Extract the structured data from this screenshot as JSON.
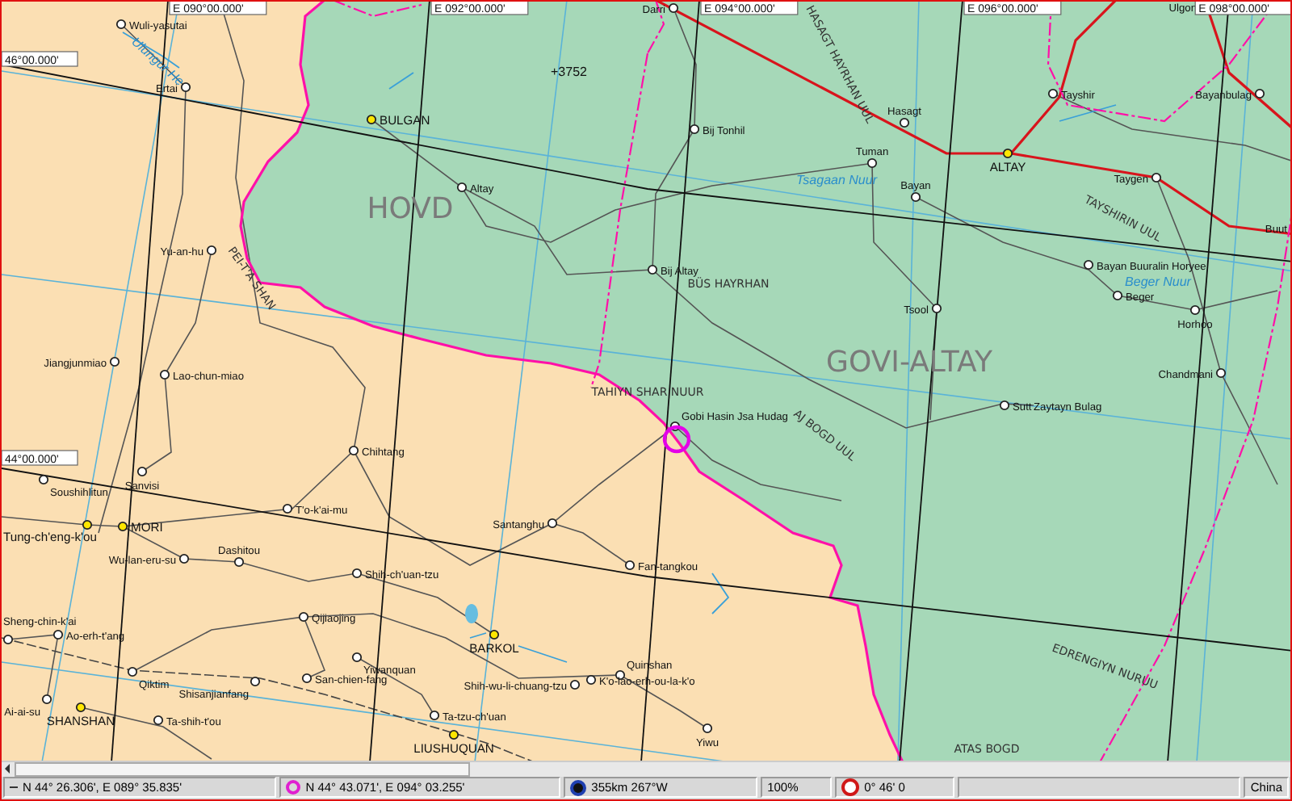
{
  "map": {
    "grid_labels": [
      {
        "text": "E 090°00.000'",
        "kind": "meridian"
      },
      {
        "text": "E 092°00.000'",
        "kind": "meridian"
      },
      {
        "text": "E 094°00.000'",
        "kind": "meridian"
      },
      {
        "text": "E 096°00.000'",
        "kind": "meridian"
      },
      {
        "text": "E 098°00.000'",
        "kind": "meridian"
      },
      {
        "text": "46°00.000'",
        "kind": "parallel"
      },
      {
        "text": "44°00.000'",
        "kind": "parallel"
      }
    ],
    "features": [
      {
        "name": "HOVD",
        "kind": "region"
      },
      {
        "name": "GOVI-ALTAY",
        "kind": "region"
      },
      {
        "name": "Ulungur He",
        "kind": "water"
      },
      {
        "name": "Tsagaan Nuur",
        "kind": "water"
      },
      {
        "name": "Beger Nuur",
        "kind": "water"
      },
      {
        "name": "PEI-T'A SHAN",
        "kind": "range"
      },
      {
        "name": "HASAGT HAYRHAN UUL",
        "kind": "range"
      },
      {
        "name": "TAYSHIRIN UUL",
        "kind": "range"
      },
      {
        "name": "BÜS HAYRHAN",
        "kind": "range"
      },
      {
        "name": "TAHIYN SHAR NUUR",
        "kind": "range"
      },
      {
        "name": "AJ BOGD UUL",
        "kind": "range"
      },
      {
        "name": "EDRENGIYN NURUU",
        "kind": "range"
      },
      {
        "name": "ATAS BOGD",
        "kind": "range"
      },
      {
        "name": "+3752",
        "kind": "peak"
      }
    ],
    "places": [
      {
        "name": "Wuli-yasutai",
        "kind": "town"
      },
      {
        "name": "Darri",
        "kind": "town"
      },
      {
        "name": "Ulgon",
        "kind": "town"
      },
      {
        "name": "Ertai",
        "kind": "town"
      },
      {
        "name": "Bayanbulag",
        "kind": "town"
      },
      {
        "name": "Tayshir",
        "kind": "town"
      },
      {
        "name": "BULGAN",
        "kind": "city"
      },
      {
        "name": "Hasagt",
        "kind": "town"
      },
      {
        "name": "Bij Tonhil",
        "kind": "town"
      },
      {
        "name": "ALTAY",
        "kind": "city"
      },
      {
        "name": "Tuman",
        "kind": "town"
      },
      {
        "name": "Taygen",
        "kind": "town"
      },
      {
        "name": "Altay",
        "kind": "town"
      },
      {
        "name": "Bayan",
        "kind": "town"
      },
      {
        "name": "Buut",
        "kind": "label"
      },
      {
        "name": "Yu-an-hu",
        "kind": "town"
      },
      {
        "name": "Bij Altay",
        "kind": "town"
      },
      {
        "name": "Bayan Buuralin Horyee",
        "kind": "town"
      },
      {
        "name": "Beger",
        "kind": "town"
      },
      {
        "name": "Tsool",
        "kind": "town"
      },
      {
        "name": "Horhoo",
        "kind": "town"
      },
      {
        "name": "Jiangjunmiao",
        "kind": "town"
      },
      {
        "name": "Lao-chun-miao",
        "kind": "town"
      },
      {
        "name": "Chandmani",
        "kind": "town"
      },
      {
        "name": "Sutt",
        "kind": "town"
      },
      {
        "name": "Zaytayn Bulag",
        "kind": "label"
      },
      {
        "name": "Gobi Hasin Jsa Hudag",
        "kind": "town"
      },
      {
        "name": "Chihtang",
        "kind": "town"
      },
      {
        "name": "Sanvisi",
        "kind": "town"
      },
      {
        "name": "Soushihlitun",
        "kind": "town"
      },
      {
        "name": "T'o-k'ai-mu",
        "kind": "town"
      },
      {
        "name": "Tung-ch'eng-k'ou",
        "kind": "city"
      },
      {
        "name": "MORI",
        "kind": "city"
      },
      {
        "name": "Santanghu",
        "kind": "town"
      },
      {
        "name": "Wu-lan-eru-su",
        "kind": "town"
      },
      {
        "name": "Dashitou",
        "kind": "town"
      },
      {
        "name": "Fan-tangkou",
        "kind": "town"
      },
      {
        "name": "Shih-ch'uan-tzu",
        "kind": "town"
      },
      {
        "name": "Qijiaojing",
        "kind": "town"
      },
      {
        "name": "BARKOL",
        "kind": "city"
      },
      {
        "name": "Ao-erh-t'ang",
        "kind": "town"
      },
      {
        "name": "Sheng-chin-k'ai",
        "kind": "town"
      },
      {
        "name": "Yiwanquan",
        "kind": "town"
      },
      {
        "name": "Qiktim",
        "kind": "town"
      },
      {
        "name": "Quinshan",
        "kind": "town"
      },
      {
        "name": "San-chien-fang",
        "kind": "town"
      },
      {
        "name": "K'o-lao-erh-ou-la-k'o",
        "kind": "town"
      },
      {
        "name": "Shisanjianfang",
        "kind": "town"
      },
      {
        "name": "Shih-wu-li-chuang-tzu",
        "kind": "town"
      },
      {
        "name": "Ai-ai-su",
        "kind": "town"
      },
      {
        "name": "SHANSHAN",
        "kind": "city"
      },
      {
        "name": "Ta-tzu-ch'uan",
        "kind": "town"
      },
      {
        "name": "Ta-shih-t'ou",
        "kind": "town"
      },
      {
        "name": "Yiwu",
        "kind": "town"
      },
      {
        "name": "LIUSHUQUAN",
        "kind": "city"
      }
    ]
  },
  "status_bar": {
    "cursor_position": "N 44° 26.306', E 089° 35.835'",
    "target_position": "N 44° 43.071', E 094° 03.255'",
    "distance_bearing": "355km 267°W",
    "zoom": "100%",
    "offset": "0° 46' 0",
    "country": "China"
  }
}
